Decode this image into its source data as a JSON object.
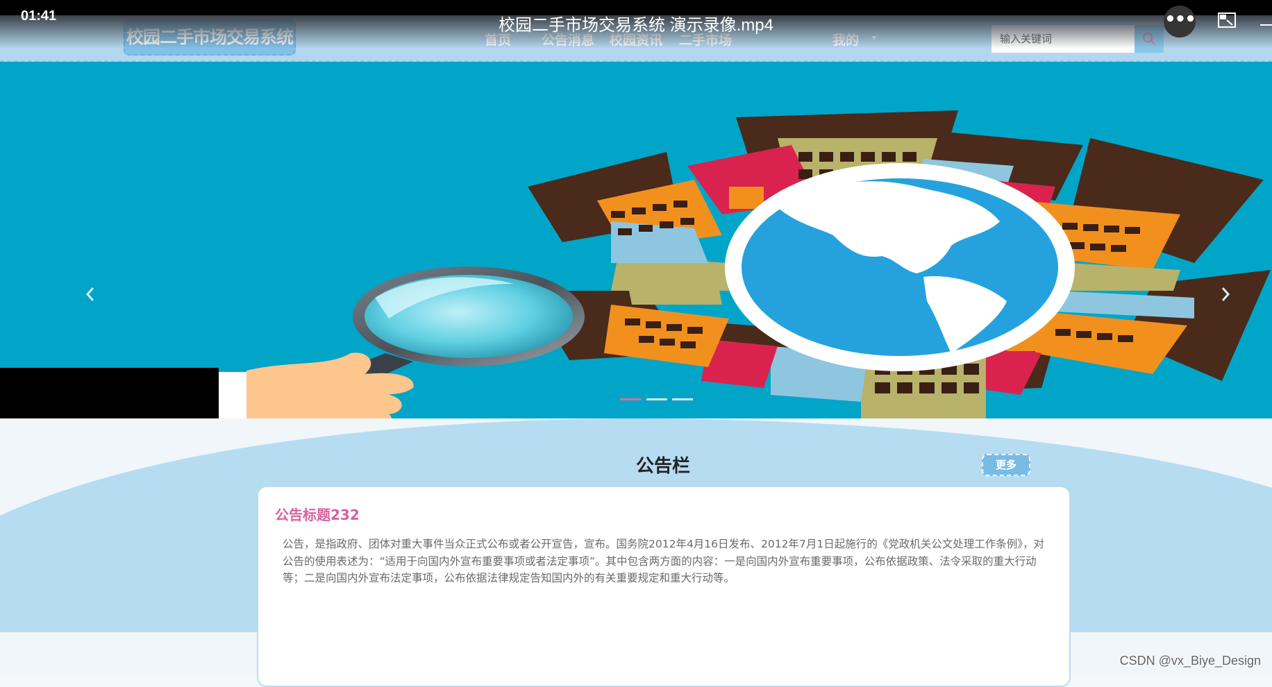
{
  "video": {
    "time": "01:41",
    "title": "校园二手市场交易系统 演示录像.mp4",
    "more_icon": "ellipsis-icon",
    "pip_icon": "picture-in-picture-icon",
    "minimize_icon": "minimize-icon"
  },
  "header": {
    "logo": "校园二手市场交易系统",
    "nav": [
      "首页",
      "公告消息",
      "校园资讯",
      "二手市场",
      "我的"
    ],
    "search_placeholder": "输入关键词",
    "search_icon": "search-icon"
  },
  "banner": {
    "prev_icon": "chevron-left-icon",
    "next_icon": "chevron-right-icon",
    "slide_count": 3,
    "active_slide": 1
  },
  "notice": {
    "section_title": "公告栏",
    "more_label": "更多",
    "item_title": "公告标题232",
    "item_body": "公告，是指政府、团体对重大事件当众正式公布或者公开宣告，宣布。国务院2012年4月16日发布、2012年7月1日起施行的《党政机关公文处理工作条例》，对公告的使用表述为：“适用于向国内外宣布重要事项或者法定事项”。其中包含两方面的内容：一是向国内外宣布重要事项，公布依据政策、法令采取的重大行动等；二是向国内外宣布法定事项，公布依据法律规定告知国内外的有关重要规定和重大行动等。"
  },
  "watermark": "CSDN @vx_Biye_Design",
  "colors": {
    "header_bg": "#b3d7ee",
    "banner_bg": "#00a5c8",
    "accent_pink": "#d9609b",
    "section_wave": "#b6dcf1"
  }
}
